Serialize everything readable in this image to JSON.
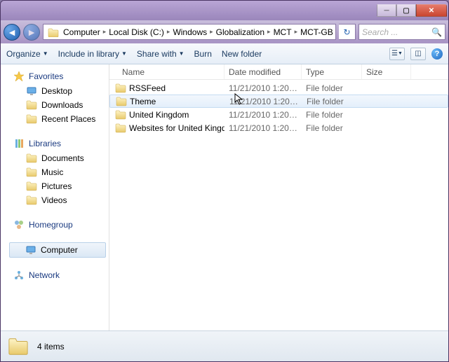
{
  "breadcrumb": [
    "Computer",
    "Local Disk (C:)",
    "Windows",
    "Globalization",
    "MCT",
    "MCT-GB"
  ],
  "search_placeholder": "Search ...",
  "toolbar": {
    "organize": "Organize",
    "include": "Include in library",
    "share": "Share with",
    "burn": "Burn",
    "newfolder": "New folder"
  },
  "nav": {
    "favorites": "Favorites",
    "desktop": "Desktop",
    "downloads": "Downloads",
    "recent": "Recent Places",
    "libraries": "Libraries",
    "documents": "Documents",
    "music": "Music",
    "pictures": "Pictures",
    "videos": "Videos",
    "homegroup": "Homegroup",
    "computer": "Computer",
    "network": "Network"
  },
  "columns": {
    "name": "Name",
    "date": "Date modified",
    "type": "Type",
    "size": "Size"
  },
  "rows": [
    {
      "name": "RSSFeed",
      "date": "11/21/2010 1:20 A...",
      "type": "File folder"
    },
    {
      "name": "Theme",
      "date": "11/21/2010 1:20 A...",
      "type": "File folder"
    },
    {
      "name": "United Kingdom",
      "date": "11/21/2010 1:20 A...",
      "type": "File folder"
    },
    {
      "name": "Websites for United Kingdom",
      "date": "11/21/2010 1:20 A...",
      "type": "File folder"
    }
  ],
  "status": "4 items"
}
